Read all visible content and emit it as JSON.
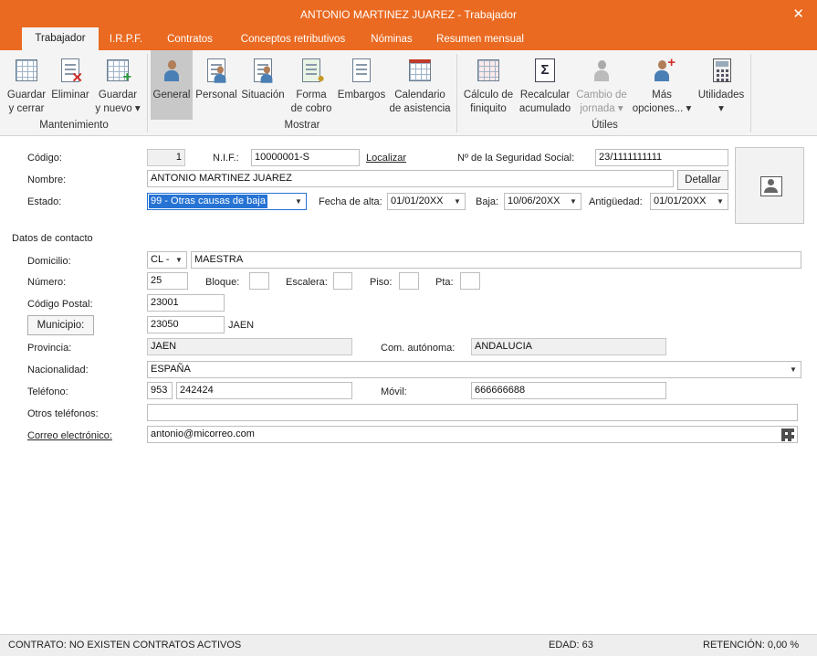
{
  "window": {
    "title": "ANTONIO MARTINEZ JUAREZ - Trabajador",
    "close": "✕"
  },
  "tabs": [
    {
      "label": "Trabajador"
    },
    {
      "label": "I.R.P.F."
    },
    {
      "label": "Contratos"
    },
    {
      "label": "Conceptos retributivos"
    },
    {
      "label": "Nóminas"
    },
    {
      "label": "Resumen mensual"
    }
  ],
  "ribbon": {
    "groups": {
      "mantenimiento": "Mantenimiento",
      "mostrar": "Mostrar",
      "utiles": "Útiles"
    },
    "buttons": {
      "guardar_cerrar": {
        "l1": "Guardar",
        "l2": "y cerrar",
        "icon": "save-close-icon"
      },
      "eliminar": {
        "l1": "Eliminar",
        "icon": "delete-icon"
      },
      "guardar_nuevo": {
        "l1": "Guardar",
        "l2": "y nuevo ▾",
        "icon": "save-new-icon"
      },
      "general": {
        "l1": "General",
        "icon": "worker-general-icon"
      },
      "personal": {
        "l1": "Personal",
        "icon": "worker-personal-icon"
      },
      "situacion": {
        "l1": "Situación",
        "icon": "worker-situation-icon"
      },
      "forma_cobro": {
        "l1": "Forma",
        "l2": "de cobro",
        "icon": "payment-icon"
      },
      "embargos": {
        "l1": "Embargos",
        "icon": "seizure-icon"
      },
      "calendario": {
        "l1": "Calendario",
        "l2": "de asistencia",
        "icon": "calendar-icon"
      },
      "finiquito": {
        "l1": "Cálculo de",
        "l2": "finiquito",
        "icon": "settlement-icon"
      },
      "recalcular": {
        "l1": "Recalcular",
        "l2": "acumulado",
        "icon": "sigma-icon"
      },
      "cambio_jornada": {
        "l1": "Cambio de",
        "l2": "jornada ▾",
        "icon": "shift-change-icon"
      },
      "mas_opciones": {
        "l1": "Más",
        "l2": "opciones... ▾",
        "icon": "more-options-icon"
      },
      "utilidades": {
        "l1": "Utilidades",
        "l2": "▾",
        "icon": "calculator-icon"
      }
    }
  },
  "form": {
    "codigo": {
      "label": "Código:",
      "value": "1"
    },
    "nif": {
      "label": "N.I.F.:",
      "value": "10000001-S",
      "link": "Localizar"
    },
    "seg_social": {
      "label": "Nº de la Seguridad Social:",
      "value": "23/1111111111"
    },
    "nombre": {
      "label": "Nombre:",
      "value": "ANTONIO MARTINEZ JUAREZ",
      "button": "Detallar"
    },
    "estado": {
      "label": "Estado:",
      "value": "99 - Otras causas de baja"
    },
    "fecha_alta": {
      "label": "Fecha de alta:",
      "value": "01/01/20XX"
    },
    "baja": {
      "label": "Baja:",
      "value": "10/06/20XX"
    },
    "antiguedad": {
      "label": "Antigüedad:",
      "value": "01/01/20XX"
    },
    "contacto": {
      "section": "Datos de contacto",
      "domicilio": {
        "label": "Domicilio:",
        "tipo": "CL -",
        "value": "MAESTRA"
      },
      "numero": {
        "label": "Número:",
        "value": "25"
      },
      "bloque": {
        "label": "Bloque:",
        "value": ""
      },
      "escalera": {
        "label": "Escalera:",
        "value": ""
      },
      "piso": {
        "label": "Piso:",
        "value": ""
      },
      "pta": {
        "label": "Pta:",
        "value": ""
      },
      "cp": {
        "label": "Código Postal:",
        "value": "23001"
      },
      "municipio": {
        "button": "Municipio:",
        "code": "23050",
        "name": "JAEN"
      },
      "provincia": {
        "label": "Provincia:",
        "value": "JAEN"
      },
      "com_autonoma": {
        "label": "Com. autónoma:",
        "value": "ANDALUCIA"
      },
      "nacionalidad": {
        "label": "Nacionalidad:",
        "value": "ESPAÑA"
      },
      "telefono": {
        "label": "Teléfono:",
        "prefix": "953",
        "value": "242424"
      },
      "movil": {
        "label": "Móvil:",
        "value": "666666688"
      },
      "otros_telefonos": {
        "label": "Otros teléfonos:",
        "value": ""
      },
      "correo": {
        "label": "Correo electrónico:",
        "value": "antonio@micorreo.com"
      }
    }
  },
  "status": {
    "contrato": "CONTRATO: NO EXISTEN CONTRATOS ACTIVOS",
    "edad": "EDAD: 63",
    "retencion": "RETENCIÓN: 0,00 %"
  }
}
